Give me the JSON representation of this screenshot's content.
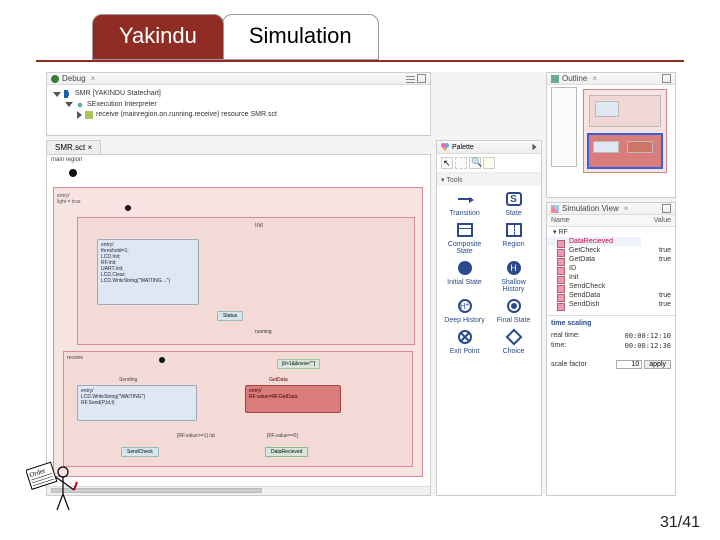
{
  "title": {
    "tab_active": "Yakindu",
    "tab_other": "Simulation"
  },
  "page_number": "31/41",
  "debug": {
    "title": "Debug",
    "launch": "SMR [YAKINDU Statechart]",
    "engine": "SExecution Interpreter",
    "frame": "receive  (mainregion.on.running.receive) resource SMR.sct"
  },
  "editor": {
    "tab": "SMR.sct",
    "region_title": "main region",
    "entry1": "entry/\nlight = true",
    "init_state": "Init",
    "init_body": "entry/\nthreshold=1;\nLCD.Init;\nRF.Init;\nUART.Init;\nLCD.Clear;\nLCD.WriteString(\"WAITING…\")",
    "btn_status": "Status",
    "receive_label": "receive",
    "running_label": "running",
    "sleep_state": "Sending",
    "sleep_body": "entry/\nLCD.WriteString(\"WAITING\")\nRF.Send(P,Id,t)",
    "getdata_label": "GetData",
    "getdata_body": "entry/\nRF.value=RF.GetData",
    "trans_rfvalue": "[RF.value>=1] /at",
    "btn_sendcheck": "SendCheck",
    "trans_rfvalue0": "[RF.value==0]",
    "btn_datarec": "DataRecieved",
    "halo": "[it>1&&new<\"\"]"
  },
  "palette": {
    "title": "Palette",
    "section": "Tools",
    "items": [
      "Transition",
      "State",
      "Composite State",
      "Region",
      "Initial State",
      "Shallow History",
      "Deep History",
      "Final State",
      "Exit Point",
      "Choice"
    ]
  },
  "outline": {
    "title": "Outline"
  },
  "simview": {
    "title": "Simulation View",
    "col_name": "Name",
    "col_value": "Value",
    "root": "RF",
    "rows": [
      {
        "name": "DataRecieved",
        "value": ""
      },
      {
        "name": "GetCheck",
        "value": "true"
      },
      {
        "name": "GetData",
        "value": "true"
      },
      {
        "name": "ID",
        "value": ""
      },
      {
        "name": "Init",
        "value": ""
      },
      {
        "name": "SendCheck",
        "value": ""
      },
      {
        "name": "SendData",
        "value": "true"
      },
      {
        "name": "SendDish",
        "value": "true"
      }
    ],
    "time_title": "time scaling",
    "realtime_label": "real time:",
    "realtime_value": "00:00:12:10",
    "simtime_label": "time:",
    "simtime_value": "00:00:12:36",
    "scale_label": "scale factor",
    "scale_value": "10",
    "apply": "apply"
  }
}
